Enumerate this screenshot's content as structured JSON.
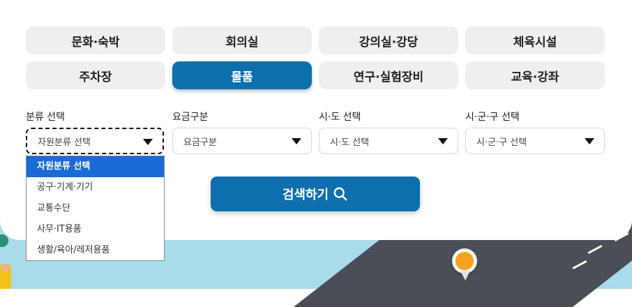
{
  "categories": [
    {
      "label": "문화·숙박",
      "active": false
    },
    {
      "label": "회의실",
      "active": false
    },
    {
      "label": "강의실·강당",
      "active": false
    },
    {
      "label": "체육시설",
      "active": false
    },
    {
      "label": "주차장",
      "active": false
    },
    {
      "label": "물품",
      "active": true
    },
    {
      "label": "연구·실험장비",
      "active": false
    },
    {
      "label": "교육·강좌",
      "active": false
    }
  ],
  "filters": {
    "category": {
      "label": "분류 선택",
      "value": "자원분류 선택"
    },
    "fee": {
      "label": "요금구분",
      "value": "요금구분"
    },
    "region": {
      "label": "시·도 선택",
      "value": "시·도 선택"
    },
    "district": {
      "label": "시·군·구 선택",
      "value": "시·군·구 선택"
    }
  },
  "dropdown": {
    "options": [
      "자원분류 선택",
      "공구·기계·기기",
      "교통수단",
      "사무·IT용품",
      "생활/육아/레저용품"
    ],
    "selected_index": 0
  },
  "search": {
    "label": "검색하기"
  },
  "colors": {
    "accent": "#0d6fae",
    "option_highlight": "#1a6ad8",
    "tab_bg": "#efefef"
  }
}
